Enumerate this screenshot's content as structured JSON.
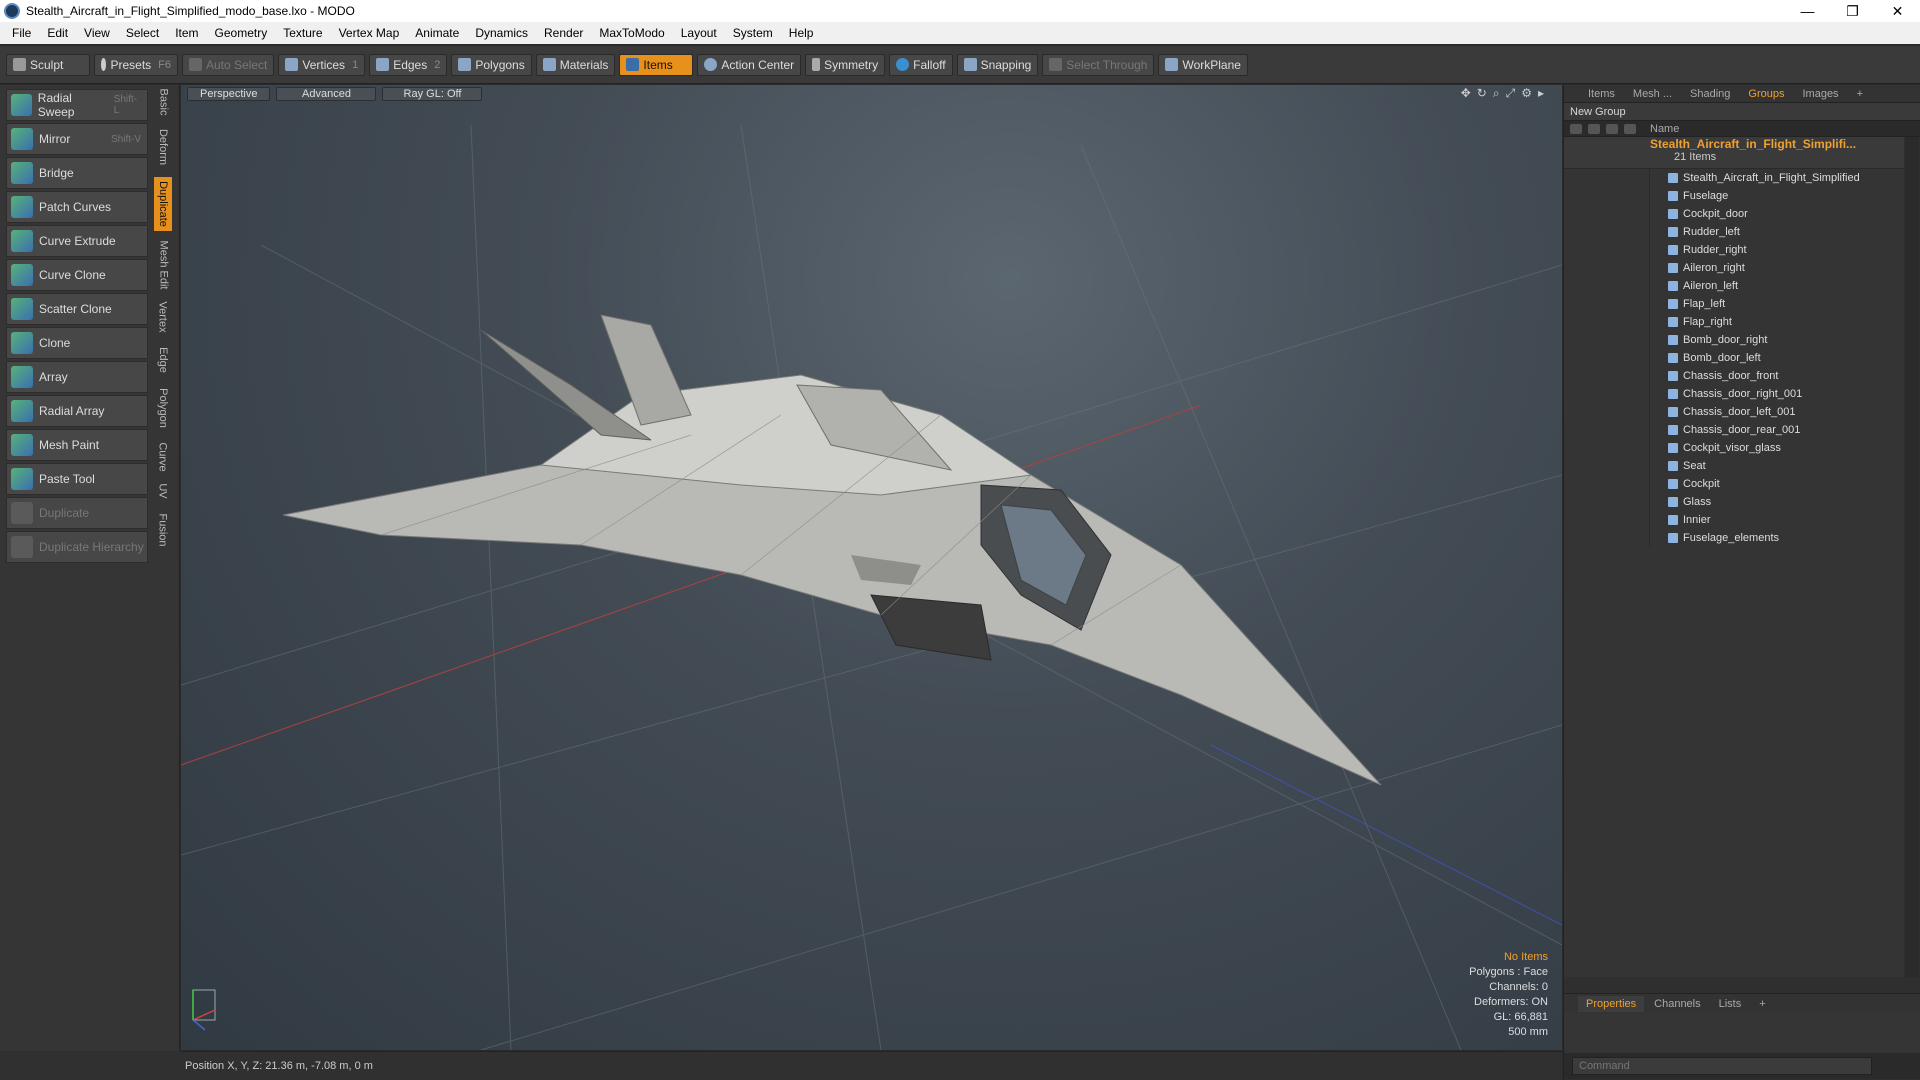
{
  "window": {
    "title": "Stealth_Aircraft_in_Flight_Simplified_modo_base.lxo - MODO",
    "buttons": [
      "—",
      "❐",
      "✕"
    ]
  },
  "menu": [
    "File",
    "Edit",
    "View",
    "Select",
    "Item",
    "Geometry",
    "Texture",
    "Vertex Map",
    "Animate",
    "Dynamics",
    "Render",
    "MaxToModo",
    "Layout",
    "System",
    "Help"
  ],
  "toolbar": {
    "sculpt": "Sculpt",
    "presets": "Presets",
    "presets_key": "F6",
    "auto_select": "Auto Select",
    "vertices": "Vertices",
    "vertices_n": "1",
    "edges": "Edges",
    "edges_n": "2",
    "polygons": "Polygons",
    "materials": "Materials",
    "items": "Items",
    "action_center": "Action Center",
    "symmetry": "Symmetry",
    "falloff": "Falloff",
    "snapping": "Snapping",
    "select_through": "Select Through",
    "workplane": "WorkPlane"
  },
  "tools": [
    {
      "label": "Radial Sweep",
      "shortcut": "Shift-L",
      "enabled": true
    },
    {
      "label": "Mirror",
      "shortcut": "Shift-V",
      "enabled": true
    },
    {
      "label": "Bridge",
      "shortcut": "",
      "enabled": true
    },
    {
      "label": "Patch Curves",
      "shortcut": "",
      "enabled": true
    },
    {
      "label": "Curve Extrude",
      "shortcut": "",
      "enabled": true
    },
    {
      "label": "Curve Clone",
      "shortcut": "",
      "enabled": true
    },
    {
      "label": "Scatter Clone",
      "shortcut": "",
      "enabled": true
    },
    {
      "label": "Clone",
      "shortcut": "",
      "enabled": true
    },
    {
      "label": "Array",
      "shortcut": "",
      "enabled": true
    },
    {
      "label": "Radial Array",
      "shortcut": "",
      "enabled": true
    },
    {
      "label": "Mesh Paint",
      "shortcut": "",
      "enabled": true
    },
    {
      "label": "Paste Tool",
      "shortcut": "",
      "enabled": true
    },
    {
      "label": "Duplicate",
      "shortcut": "",
      "enabled": false
    },
    {
      "label": "Duplicate Hierarchy",
      "shortcut": "",
      "enabled": false
    }
  ],
  "vtabs": [
    "Basic",
    "Deform",
    "Duplicate",
    "Mesh Edit",
    "Vertex",
    "Edge",
    "Polygon",
    "Curve",
    "UV",
    "Fusion"
  ],
  "viewport": {
    "view": "Perspective",
    "shading": "Advanced",
    "raygl": "Ray GL: Off",
    "info": {
      "items": "No Items",
      "polygons": "Polygons : Face",
      "channels": "Channels: 0",
      "deformers": "Deformers: ON",
      "gl": "GL: 66,881",
      "scale": "500 mm"
    }
  },
  "status": {
    "position": "Position X, Y, Z:  21.36 m, -7.08 m, 0 m"
  },
  "right": {
    "tabs": [
      "Items",
      "Mesh ...",
      "Shading",
      "Groups",
      "Images",
      "+"
    ],
    "active_tab": "Groups",
    "new_group": "New Group",
    "col_name": "Name",
    "root": {
      "name": "Stealth_Aircraft_in_Flight_Simplifi...",
      "count": "21 Items"
    },
    "items": [
      "Stealth_Aircraft_in_Flight_Simplified",
      "Fuselage",
      "Cockpit_door",
      "Rudder_left",
      "Rudder_right",
      "Aileron_right",
      "Aileron_left",
      "Flap_left",
      "Flap_right",
      "Bomb_door_right",
      "Bomb_door_left",
      "Chassis_door_front",
      "Chassis_door_right_001",
      "Chassis_door_left_001",
      "Chassis_door_rear_001",
      "Cockpit_visor_glass",
      "Seat",
      "Cockpit",
      "Glass",
      "Innier",
      "Fuselage_elements"
    ],
    "prop_tabs": [
      "Properties",
      "Channels",
      "Lists",
      "+"
    ],
    "command_placeholder": "Command"
  },
  "colors": {
    "accent": "#e8901c",
    "active_text": "#f0a030"
  }
}
